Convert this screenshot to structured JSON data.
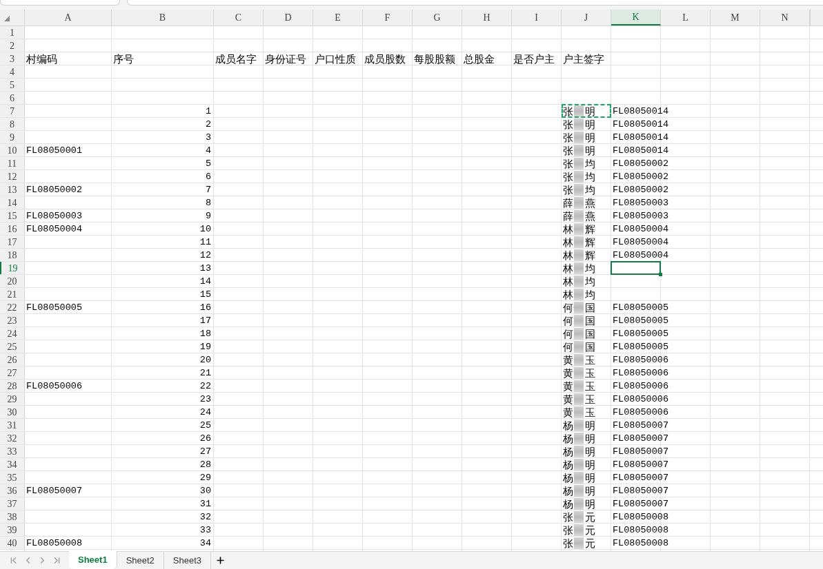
{
  "columns": [
    {
      "label": "A",
      "selected": false
    },
    {
      "label": "B",
      "selected": false
    },
    {
      "label": "C",
      "selected": false
    },
    {
      "label": "D",
      "selected": false
    },
    {
      "label": "E",
      "selected": false
    },
    {
      "label": "F",
      "selected": false
    },
    {
      "label": "G",
      "selected": false
    },
    {
      "label": "H",
      "selected": false
    },
    {
      "label": "I",
      "selected": false
    },
    {
      "label": "J",
      "selected": false
    },
    {
      "label": "K",
      "selected": true
    },
    {
      "label": "L",
      "selected": false
    },
    {
      "label": "M",
      "selected": false
    },
    {
      "label": "N",
      "selected": false
    }
  ],
  "rows": [
    {
      "number": "1",
      "selected": false
    },
    {
      "number": "2",
      "selected": false
    },
    {
      "number": "3",
      "selected": false,
      "cells": {
        "A": {
          "kind": "text",
          "text": "村编码"
        },
        "B": {
          "kind": "text",
          "text": "序号"
        },
        "C": {
          "kind": "text",
          "text": "成员名字"
        },
        "D": {
          "kind": "text",
          "text": "身份证号"
        },
        "E": {
          "kind": "text",
          "text": "户口性质"
        },
        "F": {
          "kind": "text",
          "text": "成员股数"
        },
        "G": {
          "kind": "text",
          "text": "每股股额"
        },
        "H": {
          "kind": "text",
          "text": "总股金"
        },
        "I": {
          "kind": "text",
          "text": "是否户主"
        },
        "J": {
          "kind": "text",
          "text": "户主签字"
        }
      }
    },
    {
      "number": "4",
      "selected": false
    },
    {
      "number": "5",
      "selected": false
    },
    {
      "number": "6",
      "selected": false
    },
    {
      "number": "7",
      "selected": false,
      "cells": {
        "B": {
          "kind": "number",
          "text": "1"
        },
        "J": {
          "kind": "redacted_name",
          "parts": [
            "张",
            "明"
          ],
          "copied": true
        },
        "K": {
          "kind": "code",
          "text": "FL08050014"
        }
      }
    },
    {
      "number": "8",
      "selected": false,
      "cells": {
        "B": {
          "kind": "number",
          "text": "2"
        },
        "J": {
          "kind": "redacted_name",
          "parts": [
            "张",
            "明"
          ]
        },
        "K": {
          "kind": "code",
          "text": "FL08050014"
        }
      }
    },
    {
      "number": "9",
      "selected": false,
      "cells": {
        "B": {
          "kind": "number",
          "text": "3"
        },
        "J": {
          "kind": "redacted_name",
          "parts": [
            "张",
            "明"
          ]
        },
        "K": {
          "kind": "code",
          "text": "FL08050014"
        }
      }
    },
    {
      "number": "10",
      "selected": false,
      "cells": {
        "A": {
          "kind": "code",
          "text": "FL08050001"
        },
        "B": {
          "kind": "number",
          "text": "4"
        },
        "J": {
          "kind": "redacted_name",
          "parts": [
            "张",
            "明"
          ]
        },
        "K": {
          "kind": "code",
          "text": "FL08050014"
        }
      }
    },
    {
      "number": "11",
      "selected": false,
      "cells": {
        "B": {
          "kind": "number",
          "text": "5"
        },
        "J": {
          "kind": "redacted_name",
          "parts": [
            "张",
            "均"
          ]
        },
        "K": {
          "kind": "code",
          "text": "FL08050002"
        }
      }
    },
    {
      "number": "12",
      "selected": false,
      "cells": {
        "B": {
          "kind": "number",
          "text": "6"
        },
        "J": {
          "kind": "redacted_name",
          "parts": [
            "张",
            "均"
          ]
        },
        "K": {
          "kind": "code",
          "text": "FL08050002"
        }
      }
    },
    {
      "number": "13",
      "selected": false,
      "cells": {
        "A": {
          "kind": "code",
          "text": "FL08050002"
        },
        "B": {
          "kind": "number",
          "text": "7"
        },
        "J": {
          "kind": "redacted_name",
          "parts": [
            "张",
            "均"
          ]
        },
        "K": {
          "kind": "code",
          "text": "FL08050002"
        }
      }
    },
    {
      "number": "14",
      "selected": false,
      "cells": {
        "B": {
          "kind": "number",
          "text": "8"
        },
        "J": {
          "kind": "redacted_name",
          "parts": [
            "薛",
            "燕"
          ]
        },
        "K": {
          "kind": "code",
          "text": "FL08050003"
        }
      }
    },
    {
      "number": "15",
      "selected": false,
      "cells": {
        "A": {
          "kind": "code",
          "text": "FL08050003"
        },
        "B": {
          "kind": "number",
          "text": "9"
        },
        "J": {
          "kind": "redacted_name",
          "parts": [
            "薛",
            "燕"
          ]
        },
        "K": {
          "kind": "code",
          "text": "FL08050003"
        }
      }
    },
    {
      "number": "16",
      "selected": false,
      "cells": {
        "A": {
          "kind": "code",
          "text": "FL08050004"
        },
        "B": {
          "kind": "number",
          "text": "10"
        },
        "J": {
          "kind": "redacted_name",
          "parts": [
            "林",
            "辉"
          ]
        },
        "K": {
          "kind": "code",
          "text": "FL08050004"
        }
      }
    },
    {
      "number": "17",
      "selected": false,
      "cells": {
        "B": {
          "kind": "number",
          "text": "11"
        },
        "J": {
          "kind": "redacted_name",
          "parts": [
            "林",
            "辉"
          ]
        },
        "K": {
          "kind": "code",
          "text": "FL08050004"
        }
      }
    },
    {
      "number": "18",
      "selected": false,
      "cells": {
        "B": {
          "kind": "number",
          "text": "12"
        },
        "J": {
          "kind": "redacted_name",
          "parts": [
            "林",
            "辉"
          ]
        },
        "K": {
          "kind": "code",
          "text": "FL08050004"
        }
      }
    },
    {
      "number": "19",
      "selected": true,
      "cells": {
        "B": {
          "kind": "number",
          "text": "13"
        },
        "J": {
          "kind": "redacted_name",
          "parts": [
            "林",
            "均"
          ]
        },
        "K": {
          "kind": "empty",
          "selected": true
        }
      }
    },
    {
      "number": "20",
      "selected": false,
      "cells": {
        "B": {
          "kind": "number",
          "text": "14"
        },
        "J": {
          "kind": "redacted_name",
          "parts": [
            "林",
            "均"
          ]
        }
      }
    },
    {
      "number": "21",
      "selected": false,
      "cells": {
        "B": {
          "kind": "number",
          "text": "15"
        },
        "J": {
          "kind": "redacted_name",
          "parts": [
            "林",
            "均"
          ]
        }
      }
    },
    {
      "number": "22",
      "selected": false,
      "cells": {
        "A": {
          "kind": "code",
          "text": "FL08050005"
        },
        "B": {
          "kind": "number",
          "text": "16"
        },
        "J": {
          "kind": "redacted_name",
          "parts": [
            "何",
            "国"
          ]
        },
        "K": {
          "kind": "code",
          "text": "FL08050005"
        }
      }
    },
    {
      "number": "23",
      "selected": false,
      "cells": {
        "B": {
          "kind": "number",
          "text": "17"
        },
        "J": {
          "kind": "redacted_name",
          "parts": [
            "何",
            "国"
          ]
        },
        "K": {
          "kind": "code",
          "text": "FL08050005"
        }
      }
    },
    {
      "number": "24",
      "selected": false,
      "cells": {
        "B": {
          "kind": "number",
          "text": "18"
        },
        "J": {
          "kind": "redacted_name",
          "parts": [
            "何",
            "国"
          ]
        },
        "K": {
          "kind": "code",
          "text": "FL08050005"
        }
      }
    },
    {
      "number": "25",
      "selected": false,
      "cells": {
        "B": {
          "kind": "number",
          "text": "19"
        },
        "J": {
          "kind": "redacted_name",
          "parts": [
            "何",
            "国"
          ]
        },
        "K": {
          "kind": "code",
          "text": "FL08050005"
        }
      }
    },
    {
      "number": "26",
      "selected": false,
      "cells": {
        "B": {
          "kind": "number",
          "text": "20"
        },
        "J": {
          "kind": "redacted_name",
          "parts": [
            "黄",
            "玉"
          ]
        },
        "K": {
          "kind": "code",
          "text": "FL08050006"
        }
      }
    },
    {
      "number": "27",
      "selected": false,
      "cells": {
        "B": {
          "kind": "number",
          "text": "21"
        },
        "J": {
          "kind": "redacted_name",
          "parts": [
            "黄",
            "玉"
          ]
        },
        "K": {
          "kind": "code",
          "text": "FL08050006"
        }
      }
    },
    {
      "number": "28",
      "selected": false,
      "cells": {
        "A": {
          "kind": "code",
          "text": "FL08050006"
        },
        "B": {
          "kind": "number",
          "text": "22"
        },
        "J": {
          "kind": "redacted_name",
          "parts": [
            "黄",
            "玉"
          ]
        },
        "K": {
          "kind": "code",
          "text": "FL08050006"
        }
      }
    },
    {
      "number": "29",
      "selected": false,
      "cells": {
        "B": {
          "kind": "number",
          "text": "23"
        },
        "J": {
          "kind": "redacted_name",
          "parts": [
            "黄",
            "玉"
          ]
        },
        "K": {
          "kind": "code",
          "text": "FL08050006"
        }
      }
    },
    {
      "number": "30",
      "selected": false,
      "cells": {
        "B": {
          "kind": "number",
          "text": "24"
        },
        "J": {
          "kind": "redacted_name",
          "parts": [
            "黄",
            "玉"
          ]
        },
        "K": {
          "kind": "code",
          "text": "FL08050006"
        }
      }
    },
    {
      "number": "31",
      "selected": false,
      "cells": {
        "B": {
          "kind": "number",
          "text": "25"
        },
        "J": {
          "kind": "redacted_name",
          "parts": [
            "杨",
            "明"
          ]
        },
        "K": {
          "kind": "code",
          "text": "FL08050007"
        }
      }
    },
    {
      "number": "32",
      "selected": false,
      "cells": {
        "B": {
          "kind": "number",
          "text": "26"
        },
        "J": {
          "kind": "redacted_name",
          "parts": [
            "杨",
            "明"
          ]
        },
        "K": {
          "kind": "code",
          "text": "FL08050007"
        }
      }
    },
    {
      "number": "33",
      "selected": false,
      "cells": {
        "B": {
          "kind": "number",
          "text": "27"
        },
        "J": {
          "kind": "redacted_name",
          "parts": [
            "杨",
            "明"
          ]
        },
        "K": {
          "kind": "code",
          "text": "FL08050007"
        }
      }
    },
    {
      "number": "34",
      "selected": false,
      "cells": {
        "B": {
          "kind": "number",
          "text": "28"
        },
        "J": {
          "kind": "redacted_name",
          "parts": [
            "杨",
            "明"
          ]
        },
        "K": {
          "kind": "code",
          "text": "FL08050007"
        }
      }
    },
    {
      "number": "35",
      "selected": false,
      "cells": {
        "B": {
          "kind": "number",
          "text": "29"
        },
        "J": {
          "kind": "redacted_name",
          "parts": [
            "杨",
            "明"
          ]
        },
        "K": {
          "kind": "code",
          "text": "FL08050007"
        }
      }
    },
    {
      "number": "36",
      "selected": false,
      "cells": {
        "A": {
          "kind": "code",
          "text": "FL08050007"
        },
        "B": {
          "kind": "number",
          "text": "30"
        },
        "J": {
          "kind": "redacted_name",
          "parts": [
            "杨",
            "明"
          ]
        },
        "K": {
          "kind": "code",
          "text": "FL08050007"
        }
      }
    },
    {
      "number": "37",
      "selected": false,
      "cells": {
        "B": {
          "kind": "number",
          "text": "31"
        },
        "J": {
          "kind": "redacted_name",
          "parts": [
            "杨",
            "明"
          ]
        },
        "K": {
          "kind": "code",
          "text": "FL08050007"
        }
      }
    },
    {
      "number": "38",
      "selected": false,
      "cells": {
        "B": {
          "kind": "number",
          "text": "32"
        },
        "J": {
          "kind": "redacted_name",
          "parts": [
            "张",
            "元"
          ]
        },
        "K": {
          "kind": "code",
          "text": "FL08050008"
        }
      }
    },
    {
      "number": "39",
      "selected": false,
      "cells": {
        "B": {
          "kind": "number",
          "text": "33"
        },
        "J": {
          "kind": "redacted_name",
          "parts": [
            "张",
            "元"
          ]
        },
        "K": {
          "kind": "code",
          "text": "FL08050008"
        }
      }
    },
    {
      "number": "40",
      "selected": false,
      "cells": {
        "A": {
          "kind": "code",
          "text": "FL08050008"
        },
        "B": {
          "kind": "number",
          "text": "34"
        },
        "J": {
          "kind": "redacted_name",
          "parts": [
            "张",
            "元"
          ]
        },
        "K": {
          "kind": "code",
          "text": "FL08050008"
        }
      }
    }
  ],
  "sheet_tabs": [
    {
      "label": "Sheet1",
      "selected": true
    },
    {
      "label": "Sheet2",
      "selected": false
    },
    {
      "label": "Sheet3",
      "selected": false
    }
  ]
}
